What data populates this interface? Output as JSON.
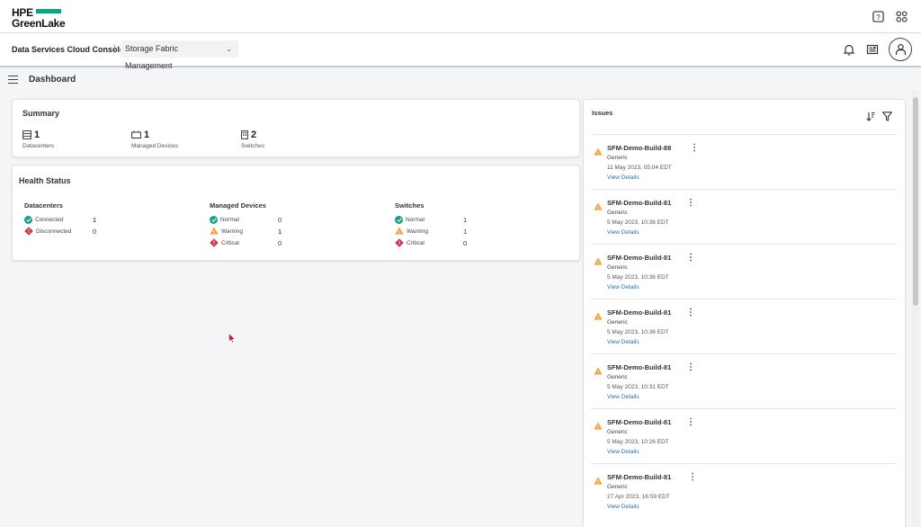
{
  "brand": {
    "line1": "HPE",
    "line2": "GreenLake",
    "accent": "#01a982"
  },
  "topbar": {
    "icons": [
      "help-icon",
      "apps-grid-icon"
    ]
  },
  "subbar": {
    "console_name": "Data Services Cloud Console",
    "separator": "|",
    "service": "Storage Fabric Management",
    "icons": [
      "notification-bell-icon",
      "news-icon",
      "user-avatar-icon"
    ]
  },
  "page": {
    "title": "Dashboard"
  },
  "summary": {
    "title": "Summary",
    "stats": [
      {
        "value": "1",
        "label": "Datacenters",
        "icon": "datacenter-icon"
      },
      {
        "value": "1",
        "label": "Managed Devices",
        "icon": "device-icon"
      },
      {
        "value": "2",
        "label": "Switches",
        "icon": "switch-icon"
      }
    ]
  },
  "health": {
    "title": "Health Status",
    "datacenters": {
      "title": "Datacenters",
      "rows": [
        {
          "label": "Connected",
          "value": "1",
          "status": "ok"
        },
        {
          "label": "Disconnected",
          "value": "0",
          "status": "critical"
        }
      ]
    },
    "devices": {
      "title": "Managed Devices",
      "rows": [
        {
          "label": "Normal",
          "value": "0",
          "status": "ok"
        },
        {
          "label": "Warning",
          "value": "1",
          "status": "warning"
        },
        {
          "label": "Critical",
          "value": "0",
          "status": "critical"
        }
      ]
    },
    "switches": {
      "title": "Switches",
      "rows": [
        {
          "label": "Normal",
          "value": "1",
          "status": "ok"
        },
        {
          "label": "Warning",
          "value": "1",
          "status": "warning"
        },
        {
          "label": "Critical",
          "value": "0",
          "status": "critical"
        }
      ]
    }
  },
  "issues": {
    "title": "Issues",
    "items": [
      {
        "name": "SFM-Demo-Build-88",
        "category": "Generic",
        "date": "11 May 2023, 05:04 EDT",
        "link": "View Details"
      },
      {
        "name": "SFM-Demo-Build-81",
        "category": "Generic",
        "date": "5 May 2023, 10:36 EDT",
        "link": "View Details"
      },
      {
        "name": "SFM-Demo-Build-81",
        "category": "Generic",
        "date": "5 May 2023, 10:36 EDT",
        "link": "View Details"
      },
      {
        "name": "SFM-Demo-Build-81",
        "category": "Generic",
        "date": "5 May 2023, 10:36 EDT",
        "link": "View Details"
      },
      {
        "name": "SFM-Demo-Build-81",
        "category": "Generic",
        "date": "5 May 2023, 10:31 EDT",
        "link": "View Details"
      },
      {
        "name": "SFM-Demo-Build-81",
        "category": "Generic",
        "date": "5 May 2023, 10:26 EDT",
        "link": "View Details"
      },
      {
        "name": "SFM-Demo-Build-81",
        "category": "Generic",
        "date": "27 Apr 2023, 16:59 EDT",
        "link": "View Details"
      }
    ]
  },
  "colors": {
    "ok": "#17a085",
    "warning": "#f0a341",
    "critical": "#d0334d",
    "link": "#1f6fb0"
  }
}
